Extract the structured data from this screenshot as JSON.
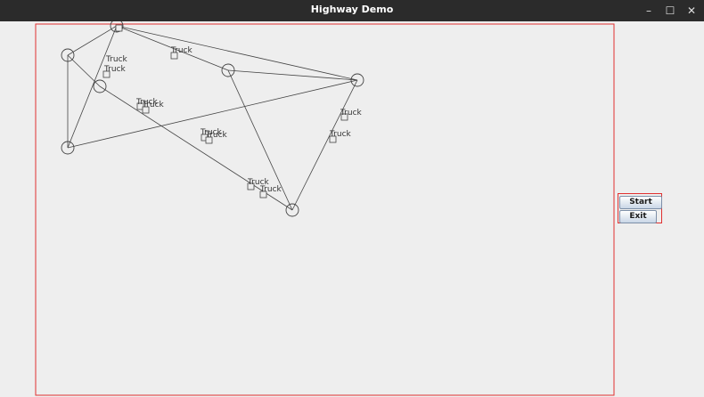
{
  "window": {
    "title": "Highway Demo",
    "minimize_glyph": "–",
    "maximize_glyph": "☐",
    "close_glyph": "✕"
  },
  "colors": {
    "titlebar": "#2b2b2b",
    "background": "#eeeeee",
    "border": "#e03030",
    "line": "#444444"
  },
  "buttons": {
    "start_label": "Start",
    "exit_label": "Exit"
  },
  "truck_label": "Truck"
}
